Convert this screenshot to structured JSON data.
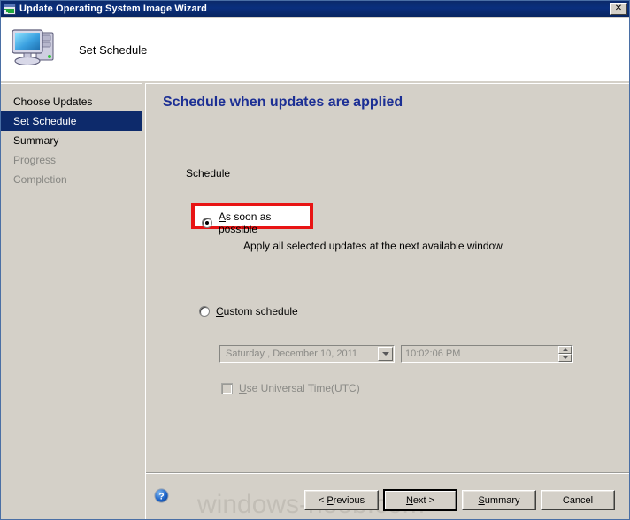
{
  "window": {
    "title": "Update Operating System Image Wizard",
    "icon": "wizard-window-icon",
    "close_label": "✕"
  },
  "header": {
    "title": "Set Schedule",
    "icon": "computer-icon"
  },
  "sidebar": {
    "items": [
      {
        "label": "Choose Updates",
        "state": "done"
      },
      {
        "label": "Set Schedule",
        "state": "active"
      },
      {
        "label": "Summary",
        "state": "done"
      },
      {
        "label": "Progress",
        "state": "disabled"
      },
      {
        "label": "Completion",
        "state": "disabled"
      }
    ]
  },
  "main": {
    "heading": "Schedule when updates are applied",
    "group_label": "Schedule",
    "asap": {
      "label_pre": "A",
      "label_post": "s soon as possible",
      "checked": true,
      "description": "Apply all selected updates at the next available window",
      "highlight_color": "#e81414"
    },
    "custom": {
      "label_pre": "C",
      "label_post": "ustom schedule",
      "checked": false
    },
    "date_field": {
      "value": "Saturday    , December 10, 2011",
      "enabled": false
    },
    "time_field": {
      "value": "10:02:06 PM",
      "enabled": false
    },
    "utc_checkbox": {
      "label_pre": "U",
      "label_post": "se Universal Time(UTC)",
      "checked": false,
      "enabled": false
    }
  },
  "footer": {
    "help_icon": "help-question-icon",
    "watermark": "windows-noob.com",
    "buttons": [
      {
        "pre": "< ",
        "acc": "P",
        "post": "revious"
      },
      {
        "pre": "",
        "acc": "N",
        "post": "ext >"
      },
      {
        "pre": "",
        "acc": "S",
        "post": "ummary"
      },
      {
        "pre": "",
        "acc": "",
        "post": "Cancel"
      }
    ]
  }
}
